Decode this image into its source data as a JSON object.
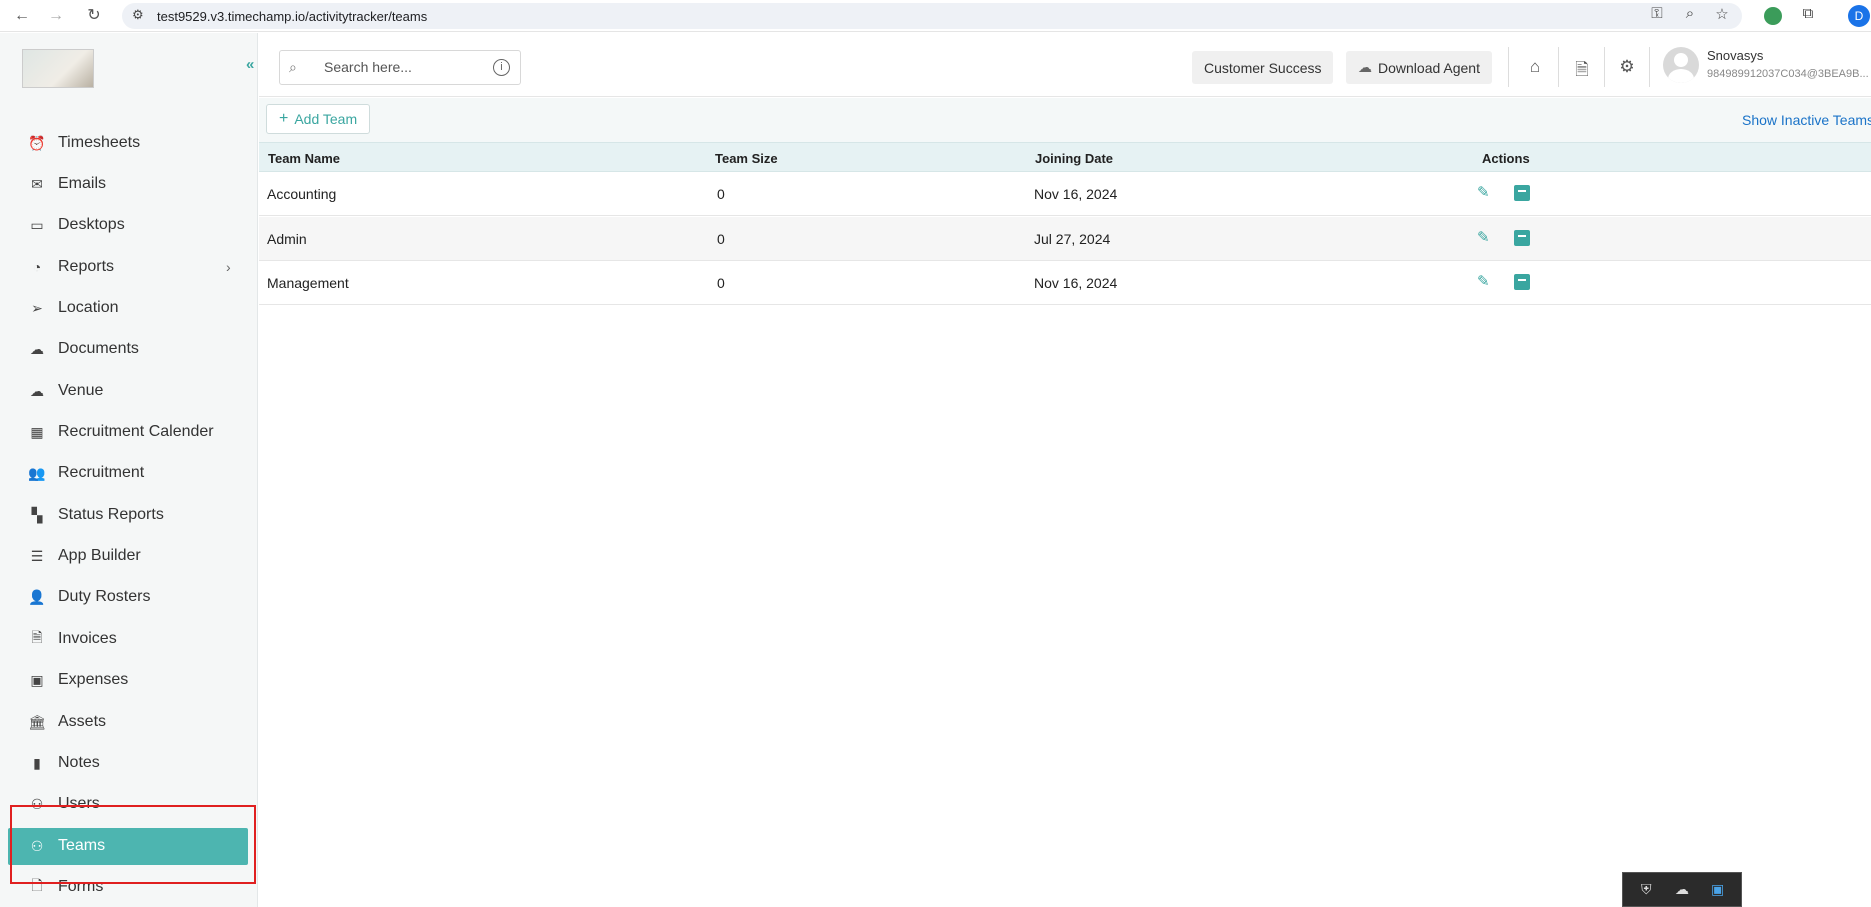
{
  "browser": {
    "url": "test9529.v3.timechamp.io/activitytracker/teams",
    "profile_initial": "D"
  },
  "sidebar": {
    "items": [
      {
        "label": "Timesheets",
        "icon": "alarm-clock-icon"
      },
      {
        "label": "Emails",
        "icon": "mail-icon"
      },
      {
        "label": "Desktops",
        "icon": "monitor-icon"
      },
      {
        "label": "Reports",
        "icon": "pie-chart-icon"
      },
      {
        "label": "Location",
        "icon": "location-arrow-icon"
      },
      {
        "label": "Documents",
        "icon": "cloud-icon"
      },
      {
        "label": "Venue",
        "icon": "cloud-icon"
      },
      {
        "label": "Recruitment Calender",
        "icon": "calendar-icon"
      },
      {
        "label": "Recruitment",
        "icon": "people-icon"
      },
      {
        "label": "Status Reports",
        "icon": "dashboard-icon"
      },
      {
        "label": "App Builder",
        "icon": "list-box-icon"
      },
      {
        "label": "Duty Rosters",
        "icon": "person-add-icon"
      },
      {
        "label": "Invoices",
        "icon": "invoice-icon"
      },
      {
        "label": "Expenses",
        "icon": "wallet-icon"
      },
      {
        "label": "Assets",
        "icon": "bank-icon"
      },
      {
        "label": "Notes",
        "icon": "notebook-icon"
      },
      {
        "label": "Users",
        "icon": "users-icon"
      },
      {
        "label": "Teams",
        "icon": "teams-icon"
      },
      {
        "label": "Forms",
        "icon": "form-icon"
      }
    ],
    "active": "Teams"
  },
  "header": {
    "search_placeholder": "Search here...",
    "customer_success": "Customer Success",
    "download_agent": "Download Agent",
    "user_name": "Snovasys",
    "user_id": "984989912037C034@3BEA9B..."
  },
  "toolbar": {
    "add_team": "Add Team",
    "show_inactive": "Show Inactive Teams"
  },
  "table": {
    "columns": [
      "Team Name",
      "Team Size",
      "Joining Date",
      "Actions"
    ],
    "rows": [
      {
        "name": "Accounting",
        "size": "0",
        "date": "Nov 16, 2024"
      },
      {
        "name": "Admin",
        "size": "0",
        "date": "Jul 27, 2024"
      },
      {
        "name": "Management",
        "size": "0",
        "date": "Nov 16, 2024"
      }
    ]
  },
  "colors": {
    "accent": "#4db5b0",
    "link": "#1a73c8",
    "highlight_border": "#e02020"
  }
}
